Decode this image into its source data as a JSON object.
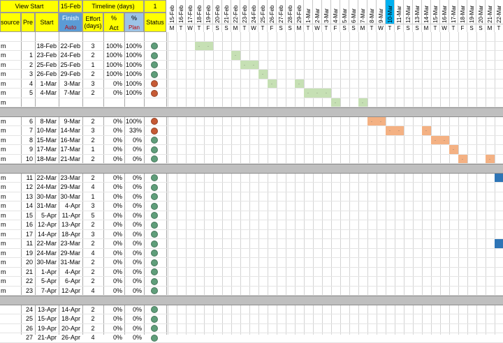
{
  "header": {
    "view_start_label": "View Start",
    "view_start_value": "15-Feb",
    "timeline_label": "Timeline (days)",
    "timeline_value": "1"
  },
  "columns": {
    "resource": "esource",
    "pre": "Pre",
    "start": "Start",
    "finish": "Finish",
    "finish_sub": "Auto",
    "effort": "Effort\n(days)",
    "pct_act": "%",
    "pct_act_sub": "Act",
    "pct_plan": "%",
    "pct_plan_sub": "Plan",
    "status": "Status"
  },
  "timeline": {
    "dates": [
      "15-Feb",
      "16-Feb",
      "17-Feb",
      "18-Feb",
      "19-Feb",
      "20-Feb",
      "21-Feb",
      "22-Feb",
      "23-Feb",
      "24-Feb",
      "25-Feb",
      "26-Feb",
      "27-Feb",
      "28-Feb",
      "29-Feb",
      "1-Mar",
      "2-Mar",
      "3-Mar",
      "4-Mar",
      "5-Mar",
      "6-Mar",
      "7-Mar",
      "8-Mar",
      "9-Mar",
      "10-Mar",
      "11-Mar",
      "12-Mar",
      "13-Mar",
      "14-Mar",
      "15-Mar",
      "16-Mar",
      "17-Mar",
      "18-Mar",
      "19-Mar",
      "20-Mar",
      "21-Mar",
      "22-Mar"
    ],
    "weekdays": [
      "M",
      "T",
      "W",
      "T",
      "F",
      "S",
      "S",
      "M",
      "T",
      "W",
      "T",
      "F",
      "S",
      "S",
      "M",
      "T",
      "W",
      "T",
      "F",
      "S",
      "S",
      "M",
      "T",
      "W",
      "T",
      "F",
      "S",
      "S",
      "M",
      "T",
      "W",
      "T",
      "F",
      "S",
      "S",
      "M",
      "T"
    ],
    "today_date": "10-Mar"
  },
  "rows": [
    {
      "type": "blank"
    },
    {
      "type": "task",
      "resource": "m",
      "pre": "",
      "start": "18-Feb",
      "finish": "22-Feb",
      "effort": "3",
      "act": "100%",
      "plan": "100%",
      "status": "green",
      "color": "green",
      "bars": [
        [
          3,
          4
        ]
      ]
    },
    {
      "type": "task",
      "resource": "m",
      "pre": "1",
      "start": "23-Feb",
      "finish": "24-Feb",
      "effort": "2",
      "act": "100%",
      "plan": "100%",
      "status": "green",
      "color": "green",
      "bars": [
        [
          7,
          7
        ]
      ]
    },
    {
      "type": "task",
      "resource": "m",
      "pre": "2",
      "start": "25-Feb",
      "finish": "25-Feb",
      "effort": "1",
      "act": "100%",
      "plan": "100%",
      "status": "green",
      "color": "green",
      "bars": [
        [
          8,
          9
        ]
      ]
    },
    {
      "type": "task",
      "resource": "m",
      "pre": "3",
      "start": "26-Feb",
      "finish": "29-Feb",
      "effort": "2",
      "act": "100%",
      "plan": "100%",
      "status": "green",
      "color": "green",
      "bars": [
        [
          10,
          10
        ]
      ]
    },
    {
      "type": "task",
      "resource": "m",
      "pre": "4",
      "start": "1-Mar",
      "finish": "3-Mar",
      "effort": "3",
      "act": "0%",
      "plan": "100%",
      "status": "red",
      "color": "green",
      "bars": [
        [
          11,
          11
        ],
        [
          14,
          14
        ]
      ]
    },
    {
      "type": "task",
      "resource": "m",
      "pre": "5",
      "start": "4-Mar",
      "finish": "7-Mar",
      "effort": "2",
      "act": "0%",
      "plan": "100%",
      "status": "red",
      "color": "green",
      "bars": [
        [
          15,
          17
        ]
      ]
    },
    {
      "type": "task",
      "resource": "m",
      "pre": "",
      "start": "",
      "finish": "",
      "effort": "",
      "act": "",
      "plan": "",
      "status": "",
      "color": "green",
      "bars": [
        [
          18,
          18
        ],
        [
          21,
          21
        ]
      ]
    },
    {
      "type": "sep"
    },
    {
      "type": "task",
      "resource": "m",
      "pre": "6",
      "start": "8-Mar",
      "finish": "9-Mar",
      "effort": "2",
      "act": "0%",
      "plan": "100%",
      "status": "red",
      "color": "orange",
      "bars": [
        [
          22,
          23
        ]
      ]
    },
    {
      "type": "task",
      "resource": "m",
      "pre": "7",
      "start": "10-Mar",
      "finish": "14-Mar",
      "effort": "3",
      "act": "0%",
      "plan": "33%",
      "status": "red",
      "color": "orange",
      "bars": [
        [
          24,
          25
        ],
        [
          28,
          28
        ]
      ]
    },
    {
      "type": "task",
      "resource": "m",
      "pre": "8",
      "start": "15-Mar",
      "finish": "16-Mar",
      "effort": "2",
      "act": "0%",
      "plan": "0%",
      "status": "green",
      "color": "orange",
      "bars": [
        [
          29,
          30
        ]
      ]
    },
    {
      "type": "task",
      "resource": "m",
      "pre": "9",
      "start": "17-Mar",
      "finish": "17-Mar",
      "effort": "1",
      "act": "0%",
      "plan": "0%",
      "status": "green",
      "color": "orange",
      "bars": [
        [
          31,
          31
        ]
      ]
    },
    {
      "type": "task",
      "resource": "m",
      "pre": "10",
      "start": "18-Mar",
      "finish": "21-Mar",
      "effort": "2",
      "act": "0%",
      "plan": "0%",
      "status": "green",
      "color": "orange",
      "bars": [
        [
          32,
          32
        ],
        [
          35,
          35
        ]
      ]
    },
    {
      "type": "sep"
    },
    {
      "type": "task",
      "resource": "m",
      "pre": "11",
      "start": "22-Mar",
      "finish": "23-Mar",
      "effort": "2",
      "act": "0%",
      "plan": "0%",
      "status": "green",
      "color": "blue",
      "bars": [
        [
          36,
          36
        ]
      ]
    },
    {
      "type": "task",
      "resource": "m",
      "pre": "12",
      "start": "24-Mar",
      "finish": "29-Mar",
      "effort": "4",
      "act": "0%",
      "plan": "0%",
      "status": "green",
      "color": "blue",
      "bars": []
    },
    {
      "type": "task",
      "resource": "m",
      "pre": "13",
      "start": "30-Mar",
      "finish": "30-Mar",
      "effort": "1",
      "act": "0%",
      "plan": "0%",
      "status": "green",
      "color": "blue",
      "bars": []
    },
    {
      "type": "task",
      "resource": "m",
      "pre": "14",
      "start": "31-Mar",
      "finish": "4-Apr",
      "effort": "3",
      "act": "0%",
      "plan": "0%",
      "status": "green",
      "color": "blue",
      "bars": []
    },
    {
      "type": "task",
      "resource": "m",
      "pre": "15",
      "start": "5-Apr",
      "finish": "11-Apr",
      "effort": "5",
      "act": "0%",
      "plan": "0%",
      "status": "green",
      "color": "blue",
      "bars": []
    },
    {
      "type": "task",
      "resource": "m",
      "pre": "16",
      "start": "12-Apr",
      "finish": "13-Apr",
      "effort": "2",
      "act": "0%",
      "plan": "0%",
      "status": "green",
      "color": "blue",
      "bars": []
    },
    {
      "type": "task",
      "resource": "m",
      "pre": "17",
      "start": "14-Apr",
      "finish": "18-Apr",
      "effort": "3",
      "act": "0%",
      "plan": "0%",
      "status": "green",
      "color": "blue",
      "bars": []
    },
    {
      "type": "task",
      "resource": "m",
      "pre": "11",
      "start": "22-Mar",
      "finish": "23-Mar",
      "effort": "2",
      "act": "0%",
      "plan": "0%",
      "status": "green",
      "color": "blue",
      "bars": [
        [
          36,
          36
        ]
      ]
    },
    {
      "type": "task",
      "resource": "m",
      "pre": "19",
      "start": "24-Mar",
      "finish": "29-Mar",
      "effort": "4",
      "act": "0%",
      "plan": "0%",
      "status": "green",
      "color": "blue",
      "bars": []
    },
    {
      "type": "task",
      "resource": "m",
      "pre": "20",
      "start": "30-Mar",
      "finish": "31-Mar",
      "effort": "2",
      "act": "0%",
      "plan": "0%",
      "status": "green",
      "color": "blue",
      "bars": []
    },
    {
      "type": "task",
      "resource": "m",
      "pre": "21",
      "start": "1-Apr",
      "finish": "4-Apr",
      "effort": "2",
      "act": "0%",
      "plan": "0%",
      "status": "green",
      "color": "blue",
      "bars": []
    },
    {
      "type": "task",
      "resource": "m",
      "pre": "22",
      "start": "5-Apr",
      "finish": "6-Apr",
      "effort": "2",
      "act": "0%",
      "plan": "0%",
      "status": "green",
      "color": "blue",
      "bars": []
    },
    {
      "type": "task",
      "resource": "m",
      "pre": "23",
      "start": "7-Apr",
      "finish": "12-Apr",
      "effort": "4",
      "act": "0%",
      "plan": "0%",
      "status": "green",
      "color": "blue",
      "bars": []
    },
    {
      "type": "sep"
    },
    {
      "type": "task",
      "resource": "",
      "pre": "24",
      "start": "13-Apr",
      "finish": "14-Apr",
      "effort": "2",
      "act": "0%",
      "plan": "0%",
      "status": "green",
      "color": "blue",
      "bars": []
    },
    {
      "type": "task",
      "resource": "",
      "pre": "25",
      "start": "15-Apr",
      "finish": "18-Apr",
      "effort": "2",
      "act": "0%",
      "plan": "0%",
      "status": "green",
      "color": "blue",
      "bars": []
    },
    {
      "type": "task",
      "resource": "",
      "pre": "26",
      "start": "19-Apr",
      "finish": "20-Apr",
      "effort": "2",
      "act": "0%",
      "plan": "0%",
      "status": "green",
      "color": "blue",
      "bars": []
    },
    {
      "type": "task",
      "resource": "",
      "pre": "27",
      "start": "21-Apr",
      "finish": "26-Apr",
      "effort": "4",
      "act": "0%",
      "plan": "0%",
      "status": "green",
      "color": "blue",
      "bars": []
    }
  ],
  "colors": {
    "header_yellow": "#ffff00",
    "header_blue": "#5b9bd5",
    "header_blue_light": "#9dc3e6",
    "auto_text": "#c00000",
    "separator": "#bfbfbf",
    "status_green": "#5f9e7a",
    "status_red": "#c65a35",
    "bar_green": "#c6e0b4",
    "bar_orange": "#f4b183",
    "bar_blue": "#2e75b6",
    "today_blue": "#00b0f0"
  }
}
